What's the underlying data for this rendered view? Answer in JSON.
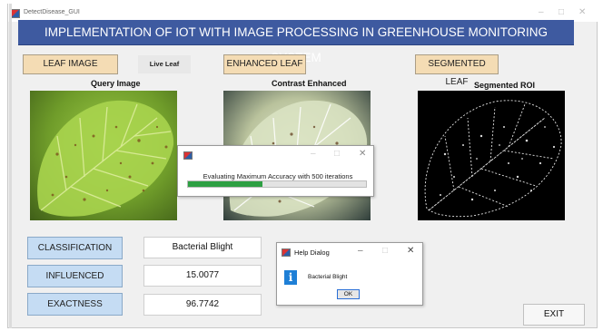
{
  "window": {
    "title": "DetectDisease_GUI"
  },
  "header": {
    "title": "IMPLEMENTATION OF IOT WITH IMAGE PROCESSING IN GREENHOUSE MONITORING SYSTEM"
  },
  "toolbar": {
    "leaf_image_label": "LEAF IMAGE",
    "live_leaf_label": "Live Leaf",
    "enhanced_leaf_label": "ENHANCED  LEAF",
    "segmented_leaf_label": "SEGMENTED LEAF"
  },
  "panels": {
    "query_caption": "Query Image",
    "enhanced_caption": "Contrast Enhanced",
    "segmented_caption": "Segmented ROI"
  },
  "progress_dialog": {
    "message": "Evaluating Maximum Accuracy with 500 iterations",
    "progress_fraction": 0.42
  },
  "results": {
    "classification_label": "CLASSIFICATION",
    "classification_value": "Bacterial Blight",
    "influenced_label": "INFLUENCED REGION",
    "influenced_value": "15.0077",
    "exactness_label": "EXACTNESS",
    "exactness_value": "96.7742"
  },
  "help_dialog": {
    "title": "Help Dialog",
    "message": "Bacterial Blight",
    "ok_label": "OK"
  },
  "exit_label": "EXIT",
  "colors": {
    "banner": "#3e5aa0",
    "tan_button": "#f4dcb4",
    "blue_button": "#c5dcf3",
    "progress": "#2ea043",
    "info_icon": "#1e7fd6"
  }
}
